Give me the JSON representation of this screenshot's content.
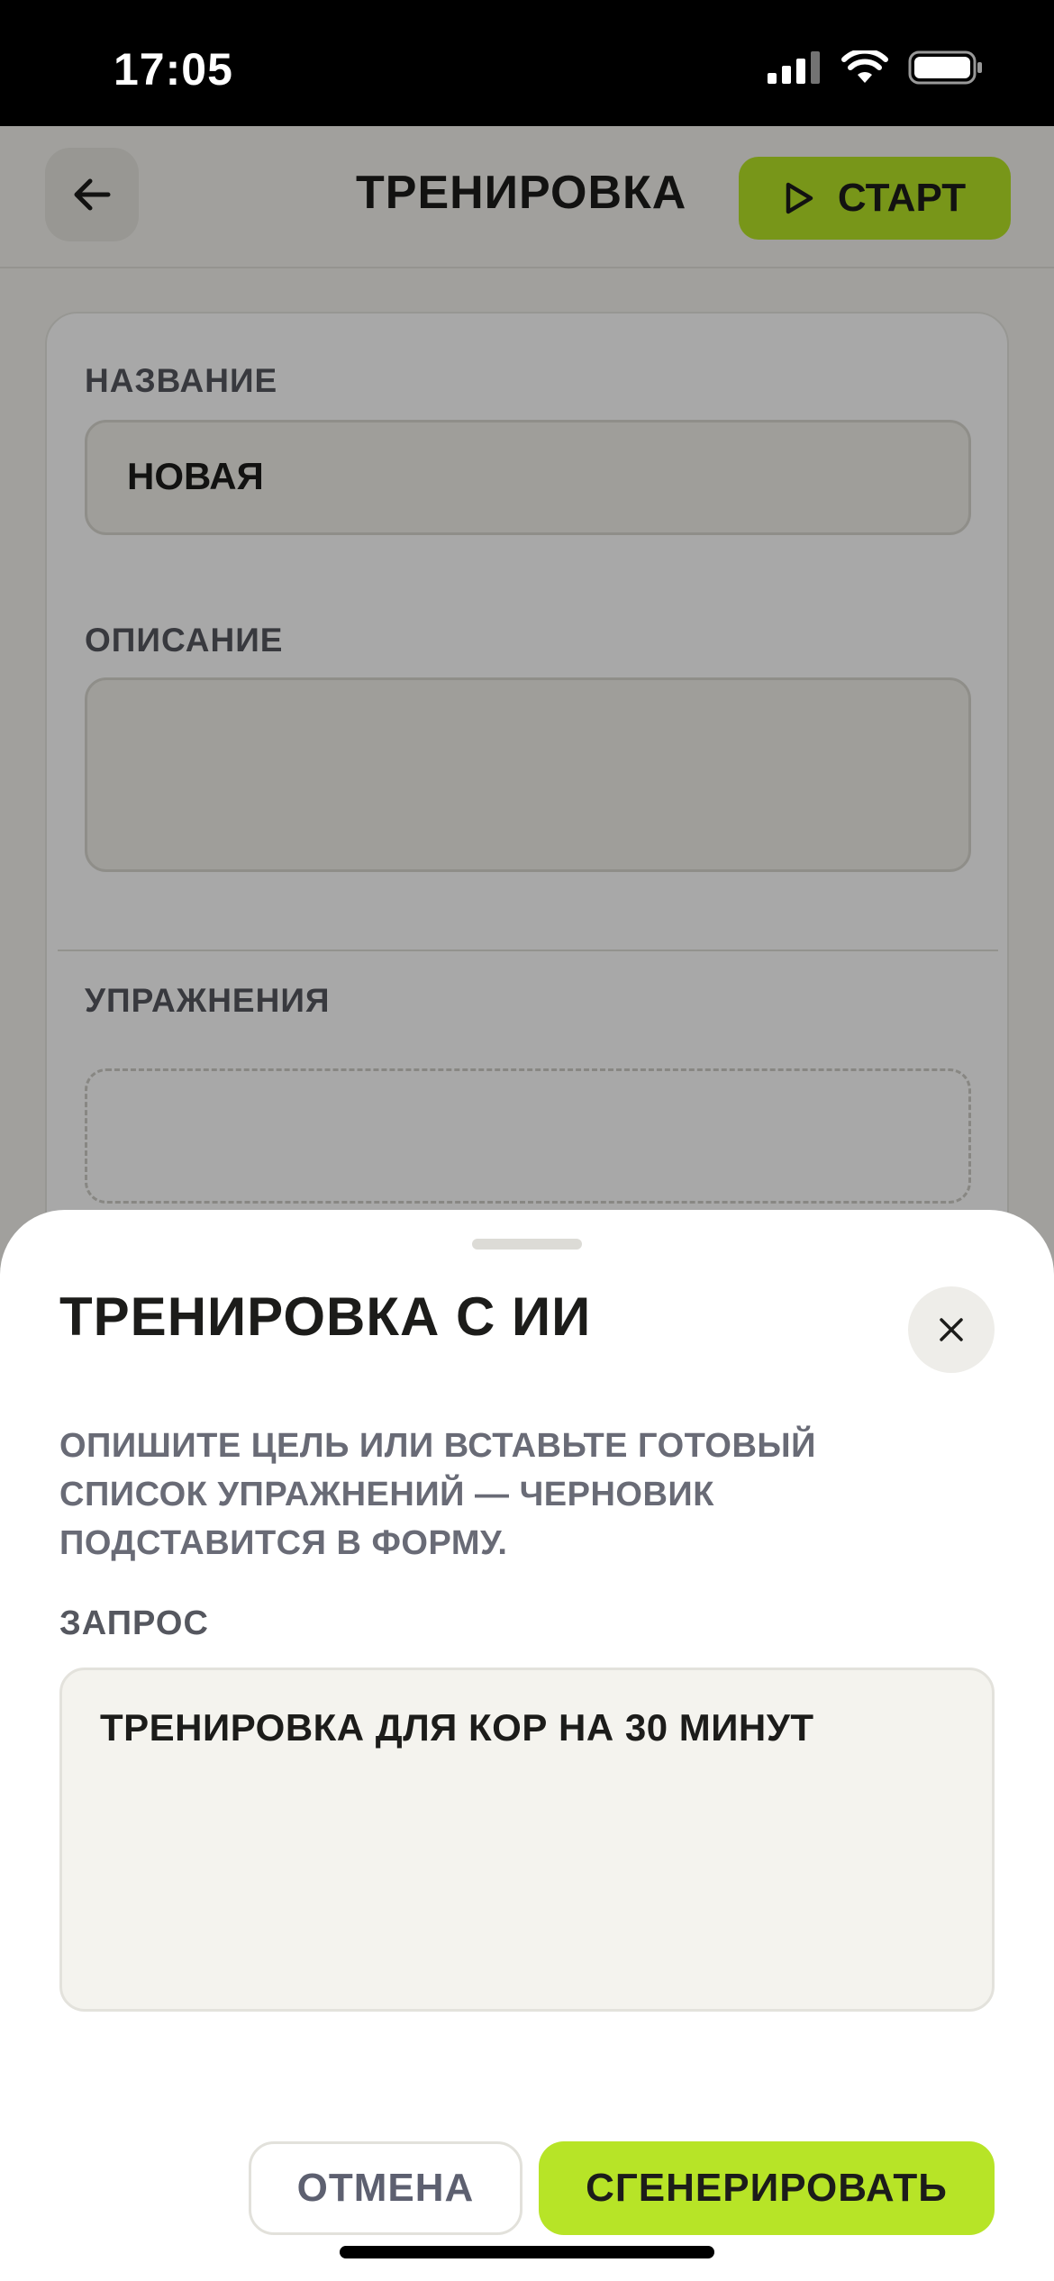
{
  "status_bar": {
    "time": "17:05",
    "icons": [
      "cellular-signal-icon",
      "wifi-icon",
      "battery-icon"
    ]
  },
  "header": {
    "back_icon": "arrow-left-icon",
    "title": "ТРЕНИРОВКА",
    "start_label": "СТАРТ",
    "start_icon": "play-icon"
  },
  "form": {
    "name_label": "НАЗВАНИЕ",
    "name_value": "НОВАЯ",
    "description_label": "ОПИСАНИЕ",
    "description_value": "",
    "exercises_label": "УПРАЖНЕНИЯ"
  },
  "sheet": {
    "title": "ТРЕНИРОВКА С ИИ",
    "close_icon": "close-icon",
    "description": "ОПИШИТЕ ЦЕЛЬ ИЛИ ВСТАВЬТЕ ГОТОВЫЙ СПИСОК УПРАЖНЕНИЙ — ЧЕРНОВИК ПОДСТАВИТСЯ В ФОРМУ.",
    "query_label": "ЗАПРОС",
    "query_value": "ТРЕНИРОВКА ДЛЯ КОР НА 30 МИНУТ",
    "cancel_label": "ОТМЕНА",
    "generate_label": "СГЕНЕРИРОВАТЬ"
  },
  "colors": {
    "accent": "#b7e427",
    "background": "#f4f3ee",
    "muted_text": "#696b76"
  }
}
